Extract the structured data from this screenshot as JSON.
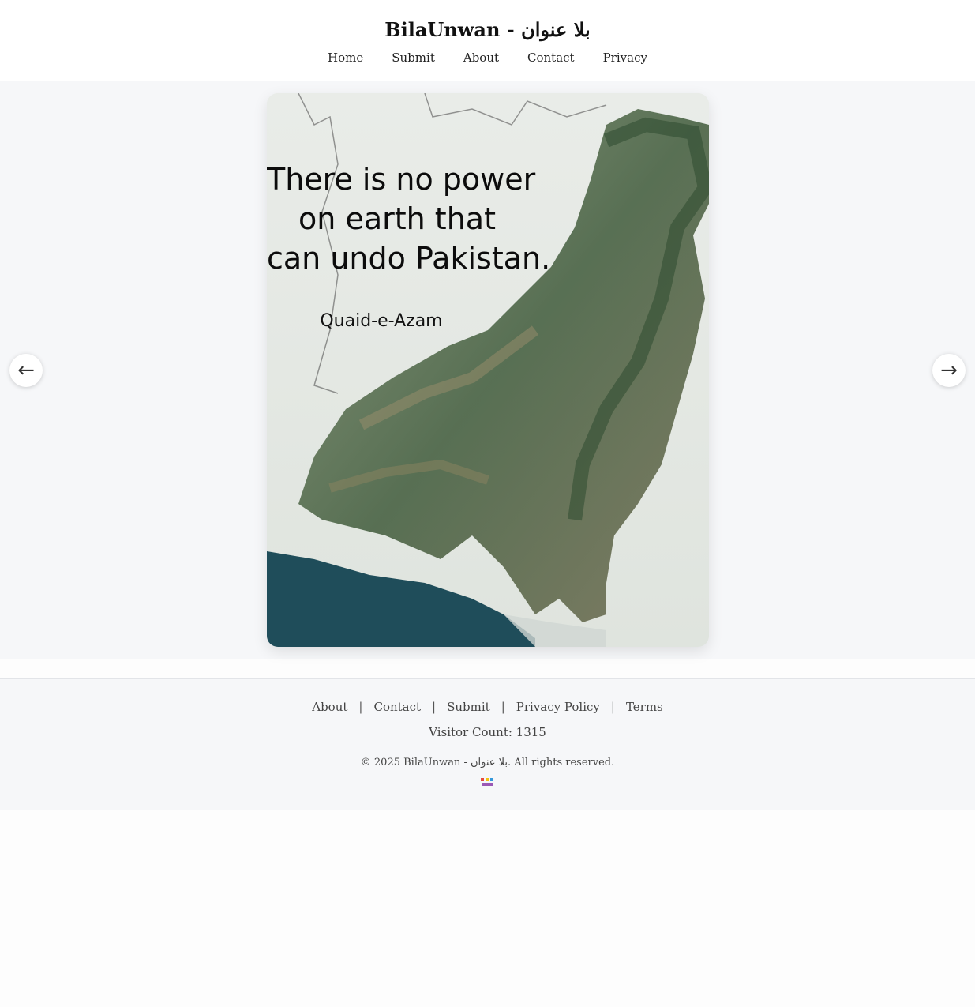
{
  "header": {
    "title": "BilaUnwan - بلا عنوان",
    "nav": [
      "Home",
      "Submit",
      "About",
      "Contact",
      "Privacy"
    ]
  },
  "slider": {
    "quote_lines": [
      "There is no power",
      "on earth that",
      "can undo Pakistan."
    ],
    "author": "Quaid-e-Azam",
    "prev_icon": "←",
    "next_icon": "→"
  },
  "footer": {
    "links": [
      "About",
      "Contact",
      "Submit",
      "Privacy Policy",
      "Terms"
    ],
    "separator": "|",
    "visitor_count": "Visitor Count: 1315",
    "copyright": "© 2025 BilaUnwan - بلا عنوان. All rights reserved.",
    "badge_icon": "site-badge-icon"
  },
  "colors": {
    "page_bg": "#fdfdfd",
    "stage_bg": "#f6f7f9",
    "map_green": "#3f5a3a",
    "sea_blue": "#1f4d5a"
  }
}
